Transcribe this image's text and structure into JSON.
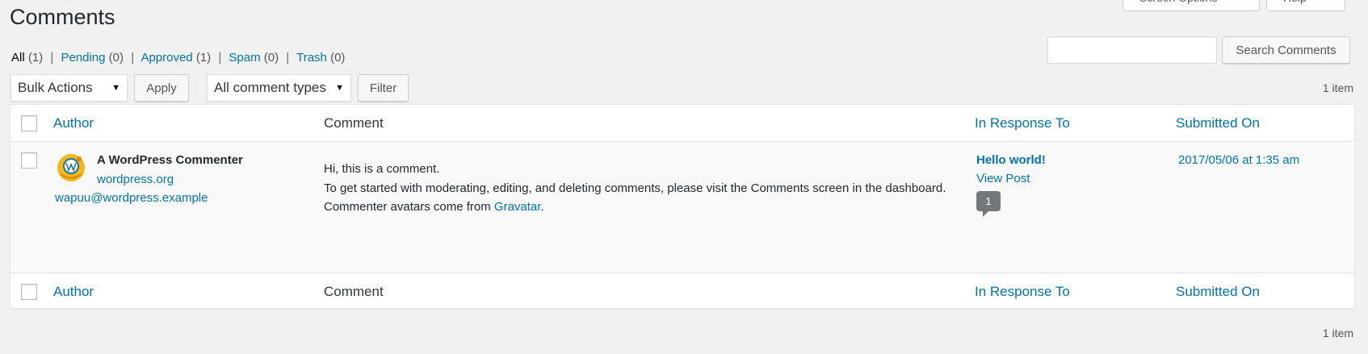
{
  "top_tabs": {
    "screen_options": "Screen Options",
    "help": "Help"
  },
  "page": {
    "title": "Comments"
  },
  "filters": [
    {
      "label": "All",
      "count": "(1)",
      "current": true
    },
    {
      "label": "Pending",
      "count": "(0)"
    },
    {
      "label": "Approved",
      "count": "(1)"
    },
    {
      "label": "Spam",
      "count": "(0)"
    },
    {
      "label": "Trash",
      "count": "(0)"
    }
  ],
  "search": {
    "value": "",
    "button": "Search Comments"
  },
  "toolbar": {
    "bulk_actions": "Bulk Actions",
    "apply": "Apply",
    "comment_types": "All comment types",
    "filter": "Filter"
  },
  "items_count": "1 item",
  "table": {
    "columns": {
      "author": "Author",
      "comment": "Comment",
      "in_response_to": "In Response To",
      "submitted_on": "Submitted On"
    },
    "rows": [
      {
        "author_name": "A WordPress Commenter",
        "author_url": "wordpress.org",
        "author_email": "wapuu@wordpress.example",
        "comment_line1": "Hi, this is a comment.",
        "comment_line2": "To get started with moderating, editing, and deleting comments, please visit the Comments screen in the dashboard.",
        "comment_line3_prefix": "Commenter avatars come from ",
        "comment_line3_link": "Gravatar",
        "comment_line3_suffix": ".",
        "response_title": "Hello world!",
        "response_view": "View Post",
        "response_count": "1",
        "submitted_on": "2017/05/06 at 1:35 am"
      }
    ]
  }
}
